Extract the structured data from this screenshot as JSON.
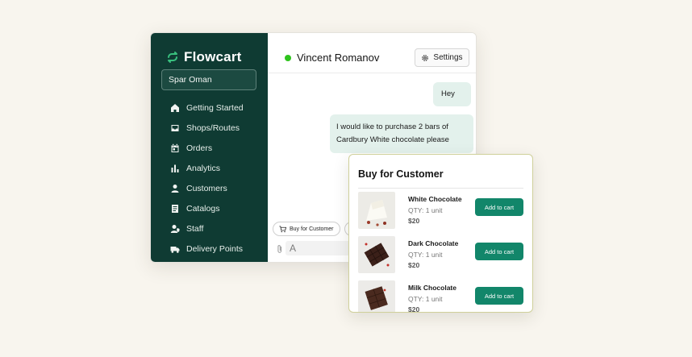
{
  "brand": {
    "name": "Flowcart"
  },
  "shop_selector": {
    "value": "Spar Oman"
  },
  "nav": {
    "items": [
      {
        "label": "Getting Started",
        "icon": "home-icon"
      },
      {
        "label": "Shops/Routes",
        "icon": "inbox-icon"
      },
      {
        "label": "Orders",
        "icon": "calendar-icon"
      },
      {
        "label": "Analytics",
        "icon": "bar-chart-icon"
      },
      {
        "label": "Customers",
        "icon": "user-icon"
      },
      {
        "label": "Catalogs",
        "icon": "catalog-icon"
      },
      {
        "label": "Staff",
        "icon": "staff-icon"
      },
      {
        "label": "Delivery Points",
        "icon": "truck-icon"
      }
    ]
  },
  "chat": {
    "contact_name": "Vincent Romanov",
    "status": "online",
    "settings_label": "Settings",
    "messages": [
      {
        "text": "Hey"
      },
      {
        "text": "I would like to purchase 2 bars of Cardbury White chocolate please"
      }
    ],
    "toolbar": {
      "buy_chip_label": "Buy for Customer",
      "input_value": "A"
    }
  },
  "buy_panel": {
    "title": "Buy for Customer",
    "products": [
      {
        "name": "White Chocolate",
        "qty": "QTY: 1 unit",
        "price": "$20",
        "button": "Add to cart"
      },
      {
        "name": "Dark Chocolate",
        "qty": "QTY: 1 unit",
        "price": "$20",
        "button": "Add to cart"
      },
      {
        "name": "Milk Chocolate",
        "qty": "QTY: 1 unit",
        "price": "$20",
        "button": "Add to cart"
      }
    ]
  },
  "colors": {
    "sidebar_bg": "#0f3b33",
    "accent": "#12866a",
    "message_bubble": "#e3f1ec",
    "online": "#2ec31d",
    "page_bg": "#f8f5ee"
  }
}
